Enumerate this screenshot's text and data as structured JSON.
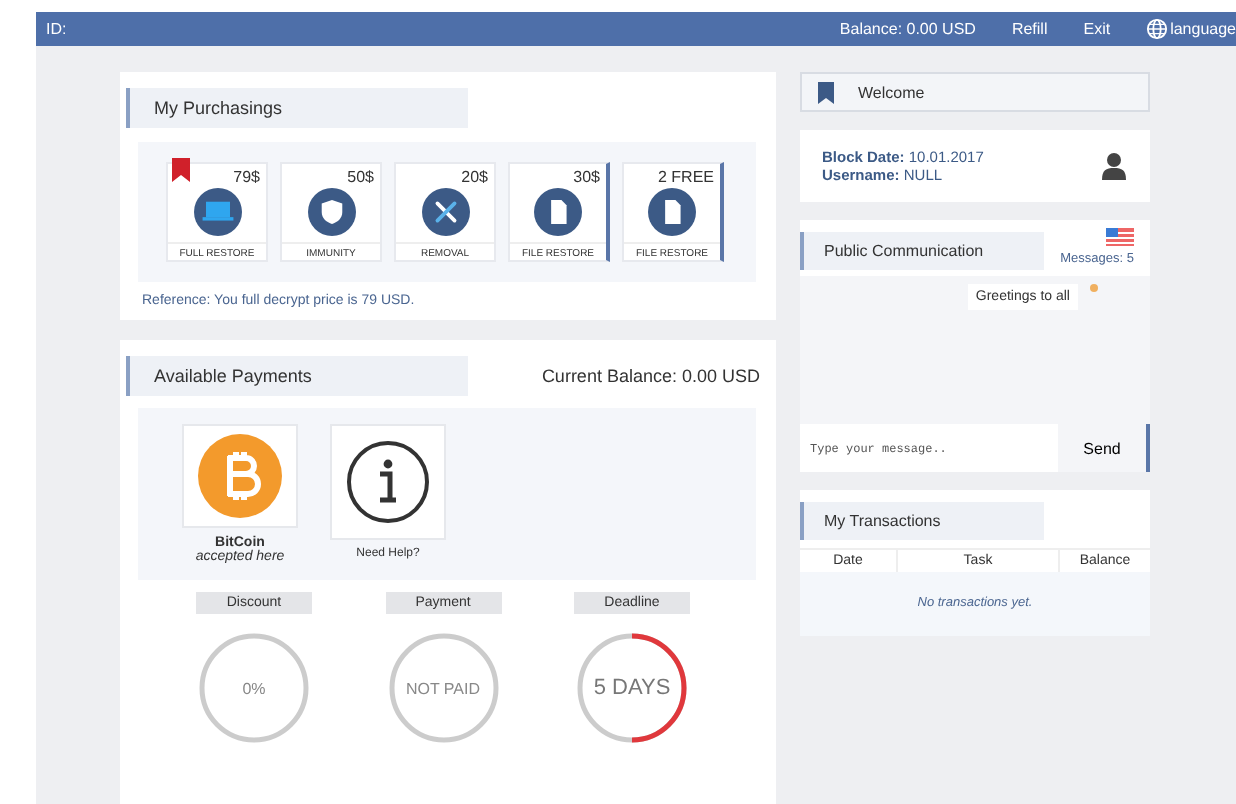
{
  "top_bar": {
    "id_label": "ID:",
    "balance": "Balance: 0.00 USD",
    "links": [
      "Refill",
      "Exit",
      "language"
    ]
  },
  "purchasings": {
    "title": "My Purchasings",
    "items": [
      {
        "price": "79$",
        "label": "FULL RESTORE",
        "kind": "laptop",
        "bookmarked": true,
        "marked": false
      },
      {
        "price": "50$",
        "label": "IMMUNITY",
        "kind": "shield",
        "bookmarked": false,
        "marked": false
      },
      {
        "price": "20$",
        "label": "REMOVAL",
        "kind": "tools",
        "bookmarked": false,
        "marked": false
      },
      {
        "price": "30$",
        "label": "FILE RESTORE",
        "kind": "file",
        "bookmarked": false,
        "marked": true
      },
      {
        "price": "2 FREE",
        "label": "FILE RESTORE",
        "kind": "file",
        "bookmarked": false,
        "marked": true
      }
    ],
    "reference": "Reference: You full decrypt price is 79 USD."
  },
  "payments": {
    "title": "Available Payments",
    "current_balance": "Current Balance: 0.00 USD",
    "methods": [
      {
        "kind": "bitcoin",
        "name": "BitCoin",
        "note": "accepted here"
      },
      {
        "kind": "help",
        "note": "Need Help?"
      }
    ],
    "stats": [
      {
        "label": "Discount",
        "value": "0%"
      },
      {
        "label": "Payment",
        "value": "NOT PAID"
      },
      {
        "label": "Deadline",
        "value": "5 DAYS",
        "level": 0.5
      }
    ]
  },
  "welcome": {
    "title": "Welcome",
    "block_date_label": "Block Date:",
    "block_date": "10.01.2017",
    "username_label": "Username:",
    "username": "NULL"
  },
  "communication": {
    "title": "Public Communication",
    "messages": "Messages: 5",
    "chat": [
      "Greetings to all"
    ],
    "placeholder": "Type your message..",
    "send": "Send"
  },
  "transactions": {
    "title": "My Transactions",
    "columns": [
      "Date",
      "Task",
      "Balance"
    ],
    "empty": "No transactions yet."
  }
}
